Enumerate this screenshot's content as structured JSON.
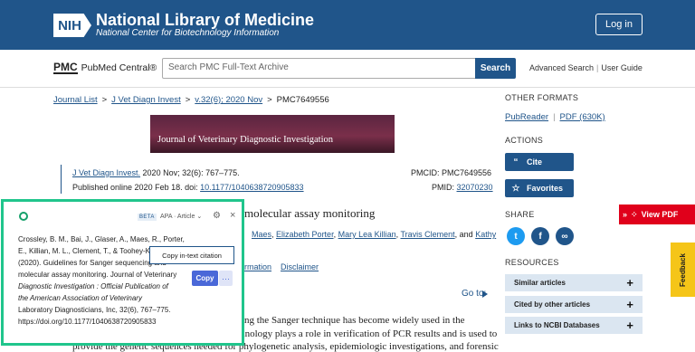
{
  "header": {
    "logo_text": "NIH",
    "org_title": "National Library of Medicine",
    "org_subtitle": "National Center for Biotechnology Information",
    "login_label": "Log in"
  },
  "pmc_bar": {
    "logo_mark": "PMC",
    "logo_name": "PubMed Central®",
    "search_placeholder": "Search PMC Full-Text Archive",
    "search_button": "Search",
    "advanced_search": "Advanced Search",
    "user_guide": "User Guide"
  },
  "breadcrumb": [
    "Journal List",
    "J Vet Diagn Invest",
    "v.32(6); 2020 Nov",
    "PMC7649556"
  ],
  "banner": {
    "title": "Journal of Veterinary Diagnostic Investigation"
  },
  "article": {
    "journal_link": "J Vet Diagn Invest.",
    "citation": " 2020 Nov; 32(6): 767–775.",
    "published_prefix": "Published online 2020 Feb 18. doi: ",
    "doi": "10.1177/1040638720905833",
    "pmcid_label": "PMCID: PMC7649556",
    "pmid_prefix": "PMID: ",
    "pmid": "32070230",
    "title_fragment": "molecular assay monitoring",
    "authors_line1": [
      "Maes",
      "Elizabeth Porter",
      "Mary Lea Killian",
      "Travis Clement"
    ],
    "authors_and": ", and ",
    "authors_last_part1": "Kathy",
    "authors_last_part2": "",
    "info_link": "rmation",
    "disclaimer": "Disclaimer",
    "goto": "Go to:",
    "body_line1": "ng the Sanger technique has become widely used in the",
    "body_line2": "veterinary diagnostic community. This technology plays a role in verification of PCR results and is used to",
    "body_line3": "provide the genetic sequences needed for phylogenetic analysis, epidemiologic investigations, and forensic"
  },
  "sidebar": {
    "other_formats": "OTHER FORMATS",
    "pubreader": "PubReader",
    "pdf": "PDF (630K)",
    "actions": "ACTIONS",
    "cite_label": "Cite",
    "favorites_label": "Favorites",
    "share": "SHARE",
    "resources": "RESOURCES",
    "resource_rows": [
      "Similar articles",
      "Cited by other articles",
      "Links to NCBI Databases"
    ],
    "view_pdf": "View PDF",
    "feedback": "Feedback"
  },
  "citation_popup": {
    "badge": "BETA",
    "style": "APA · Article",
    "text_lines": [
      "Crossley, B. M., Bai, J., Glaser, A., Maes, R., Porter,",
      "E., Killian, M. L., Clement, T., & Toohey-Kurth, K.",
      "(2020). Guidelines for Sanger sequencing and",
      "molecular assay monitoring. Journal of Veterinary",
      "Diagnostic Investigation : Official Publication of",
      "the American Association of Veterinary",
      "Laboratory Diagnosticians, Inc, 32(6), 767–775.",
      "https://doi.org/10.1177/1040638720905833"
    ],
    "tooltip": "Copy in-text citation",
    "copy_label": "Copy",
    "more_label": "···"
  },
  "colors": {
    "brand_blue": "#20558a",
    "popup_border": "#20c58c",
    "view_pdf_red": "#e0001b",
    "feedback_yellow": "#f5c518",
    "copy_button": "#4a68d8"
  },
  "icons": {
    "cite": "quote-icon",
    "favorites": "star-icon",
    "twitter": "twitter-icon",
    "facebook": "facebook-icon",
    "link": "link-icon",
    "gear": "gear-icon",
    "close": "close-icon"
  }
}
